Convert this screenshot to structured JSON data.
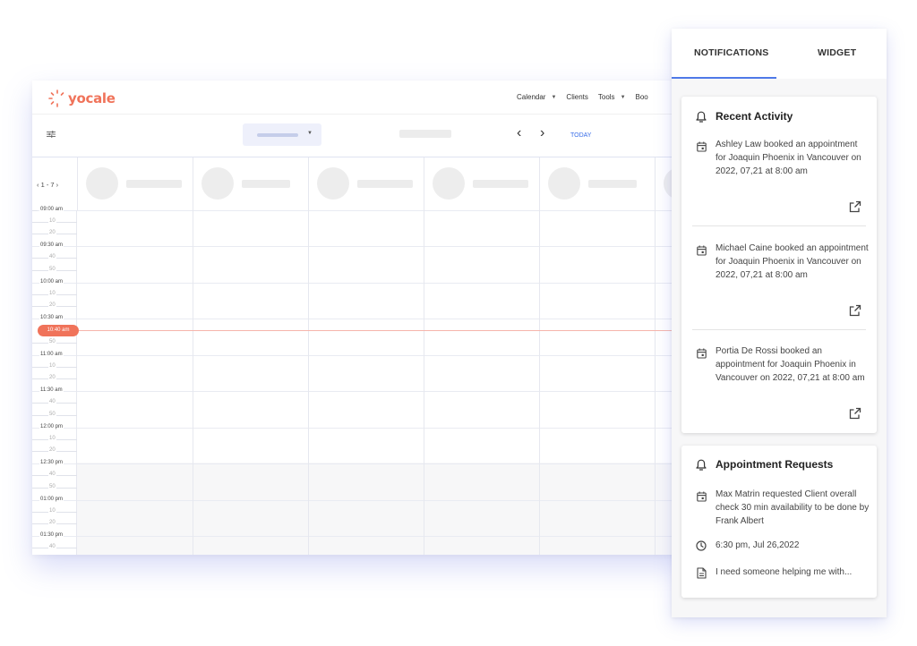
{
  "app": {
    "logo_text": "yocale",
    "nav": [
      {
        "label": "Calendar",
        "caret": "▼"
      },
      {
        "label": "Clients",
        "caret": ""
      },
      {
        "label": "Tools",
        "caret": "▼"
      },
      {
        "label": "Boo",
        "caret": ""
      }
    ],
    "toolbar": {
      "dropdown_caret": "▼",
      "prev_glyph": "‹",
      "next_glyph": "›",
      "today_label": "TODAY"
    },
    "week_label": "‹ 1 - 7 ›",
    "time_labels": {
      "t0900": "09:00 am",
      "m0910": "10",
      "m0920": "20",
      "t0930": "09:30 am",
      "m0940": "40",
      "m0950": "50",
      "t1000": "10:00 am",
      "m1010": "10",
      "m1020": "20",
      "t1030": "10:30 am",
      "m1050": "50",
      "t1100": "11:00 am",
      "m1110": "10",
      "m1120": "20",
      "t1130": "11:30 am",
      "m1140": "40",
      "m1150": "50",
      "t1200": "12:00 pm",
      "m1210": "10",
      "m1220": "20",
      "t1230": "12:30 pm",
      "m1240": "40",
      "m1250": "50",
      "t0100": "01:00 pm",
      "m0110": "10",
      "m0120": "20",
      "t0130": "01:30 pm",
      "m0140": "40"
    },
    "current_time": "10:40 am",
    "colors": {
      "brand": "#f0735a",
      "accent": "#3a6ee8"
    }
  },
  "panel": {
    "tabs": [
      {
        "label": "NOTIFICATIONS",
        "active": true
      },
      {
        "label": "WIDGET",
        "active": false
      }
    ],
    "recent_activity": {
      "title": "Recent Activity",
      "items": [
        {
          "text": "Ashley Law booked an appointment for Joaquin Phoenix in Vancouver on 2022, 07,21 at 8:00 am"
        },
        {
          "text": "Michael Caine booked an appointment for Joaquin Phoenix in Vancouver on 2022, 07,21 at 8:00 am"
        },
        {
          "text": "Portia De Rossi booked an appointment for Joaquin Phoenix in Vancouver on 2022, 07,21 at 8:00 am"
        }
      ]
    },
    "appointment_requests": {
      "title": "Appointment Requests",
      "request_text": "Max Matrin requested Client overall check 30 min availability to be done by Frank Albert",
      "time_text": "6:30 pm, Jul 26,2022",
      "note_text": "I need someone helping me with..."
    },
    "colors": {
      "tab_underline": "#4f79e8"
    }
  }
}
